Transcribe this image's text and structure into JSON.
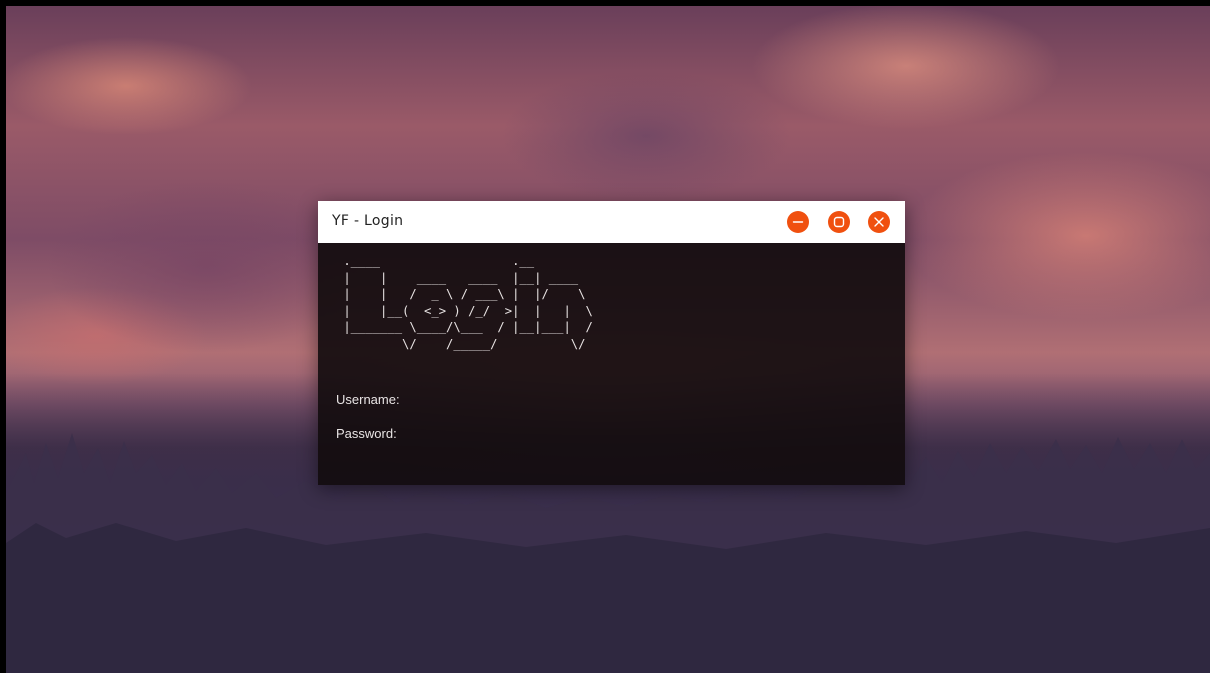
{
  "window": {
    "title": "YF - Login",
    "controls": {
      "minimize_icon": "minus-icon",
      "maximize_icon": "square-icon",
      "close_icon": "x-icon",
      "color": "#f0500f"
    }
  },
  "banner": {
    "ascii_art": " .____                  .__         \n |    |    ____   ____  |__| ____   \n |    |   /  _ \\ / ___\\ |  |/    \\  \n |    |__(  <_> ) /_/  >|  |   |  \\ \n |_______ \\____/\\___  / |__|___|  / \n         \\/    /_____/          \\/  "
  },
  "form": {
    "username_label": "Username:",
    "username_value": "",
    "password_label": "Password:",
    "password_value": ""
  }
}
